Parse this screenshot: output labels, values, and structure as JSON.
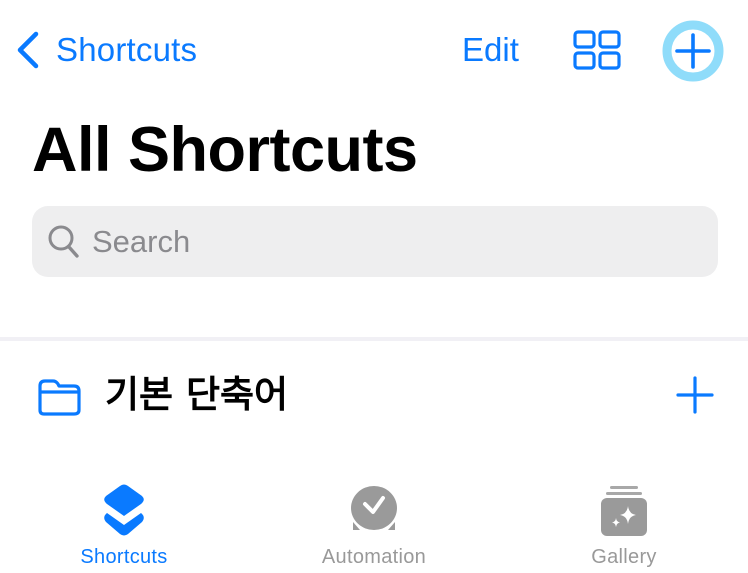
{
  "nav": {
    "back_label": "Shortcuts",
    "edit_label": "Edit",
    "grid_icon": "grid-icon",
    "add_icon": "plus-circle-icon"
  },
  "page": {
    "title": "All Shortcuts"
  },
  "search": {
    "placeholder": "Search",
    "value": ""
  },
  "folders": [
    {
      "label": "기본 단축어",
      "icon": "folder-icon"
    }
  ],
  "tabbar": {
    "tabs": [
      {
        "label": "Shortcuts",
        "icon": "shortcuts-layers-icon",
        "active": true
      },
      {
        "label": "Automation",
        "icon": "automation-clock-check-icon",
        "active": false
      },
      {
        "label": "Gallery",
        "icon": "gallery-sparkle-icon",
        "active": false
      }
    ]
  },
  "colors": {
    "accent": "#0a7aff",
    "highlight_ring": "#8fdcfa",
    "inactive": "#999999",
    "search_bg": "#eeeeef"
  }
}
